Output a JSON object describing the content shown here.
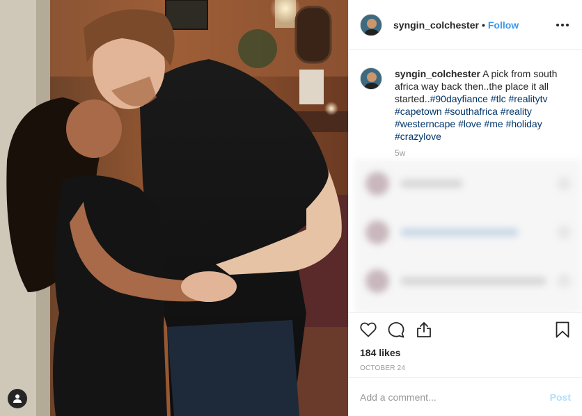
{
  "post": {
    "username": "syngin_colchester",
    "follow_label": "Follow",
    "separator": "•",
    "more_icon": "more-dots-icon",
    "caption": {
      "username": "syngin_colchester",
      "text": "A pick from south africa way back then..the place it all started..",
      "hashtags": [
        "#90dayfiance",
        "#tlc",
        "#realitytv",
        "#capetown",
        "#southafrica",
        "#reality",
        "#westerncape",
        "#love",
        "#me",
        "#holiday",
        "#crazylove"
      ]
    },
    "age": "5w",
    "likes": "184 likes",
    "date": "OCTOBER 24",
    "comment_placeholder": "Add a comment...",
    "post_label": "Post",
    "icons": [
      "heart-icon",
      "comment-icon",
      "share-icon",
      "bookmark-icon",
      "user-tag-icon"
    ]
  },
  "colors": {
    "link": "#3897f0",
    "hashtag": "#003569",
    "post_disabled": "#b2dffc",
    "muted": "#999999"
  }
}
